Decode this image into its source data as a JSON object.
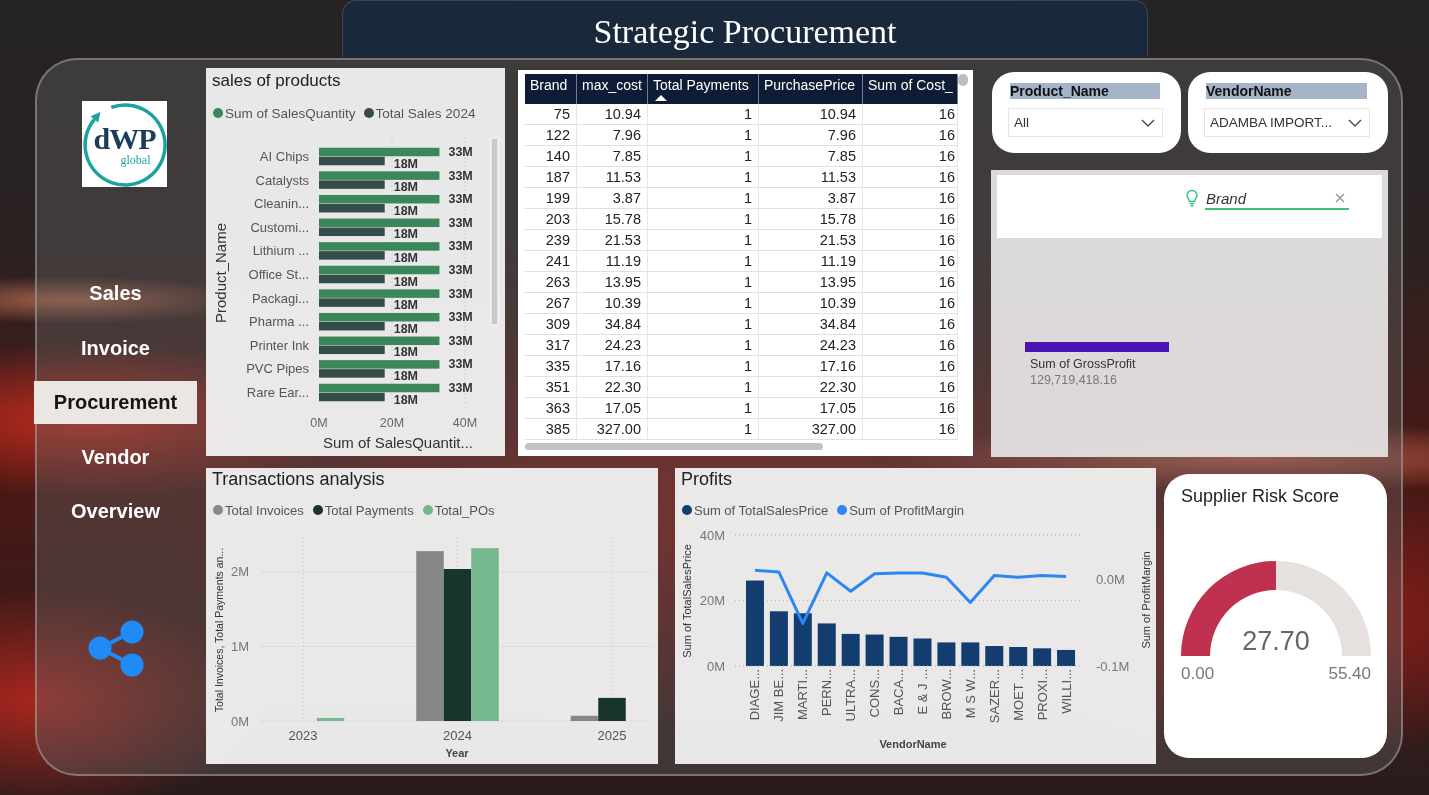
{
  "header": {
    "title": "Strategic Procurement"
  },
  "sidebar": {
    "logo": {
      "wordmark": "dWP",
      "tagline": "global"
    },
    "items": [
      {
        "label": "Sales",
        "selected": false
      },
      {
        "label": "Invoice",
        "selected": false
      },
      {
        "label": "Procurement",
        "selected": true
      },
      {
        "label": "Vendor",
        "selected": false
      },
      {
        "label": "Overview",
        "selected": false
      }
    ]
  },
  "sales_chart": {
    "chart_data": {
      "type": "bar",
      "orientation": "horizontal",
      "title": "sales of products",
      "xlabel": "Sum of SalesQuantit...",
      "ylabel": "Product_Name",
      "categories": [
        "AI Chips",
        "Catalysts",
        "Cleanin...",
        "Customi...",
        "Lithium ...",
        "Office St...",
        "Packagi...",
        "Pharma ...",
        "Printer Ink",
        "PVC Pipes",
        "Rare Ear..."
      ],
      "series": [
        {
          "name": "Sum of SalesQuantity",
          "color": "#3b875b",
          "values": [
            33000000,
            33000000,
            33000000,
            33000000,
            33000000,
            33000000,
            33000000,
            33000000,
            33000000,
            33000000,
            33000000
          ]
        },
        {
          "name": "Total Sales 2024",
          "color": "#354d48",
          "values": [
            18000000,
            18000000,
            18000000,
            18000000,
            18000000,
            18000000,
            18000000,
            18000000,
            18000000,
            18000000,
            18000000
          ]
        }
      ],
      "xlim": [
        0,
        40000000
      ],
      "xticks": [
        {
          "value": 0,
          "label": "0M"
        },
        {
          "value": 20000000,
          "label": "20M"
        },
        {
          "value": 40000000,
          "label": "40M"
        }
      ],
      "value_labels": [
        [
          "33M",
          "33M",
          "33M",
          "33M",
          "33M",
          "33M",
          "33M",
          "33M",
          "33M",
          "33M",
          "33M"
        ],
        [
          "18M",
          "18M",
          "18M",
          "18M",
          "18M",
          "18M",
          "18M",
          "18M",
          "18M",
          "18M",
          "18M"
        ]
      ],
      "legend": "top-left",
      "grid": true
    }
  },
  "brand_table": {
    "columns": [
      {
        "label": "Brand",
        "sorted": false
      },
      {
        "label": "max_cost",
        "sorted": false
      },
      {
        "label": "Total Payments",
        "sorted": true
      },
      {
        "label": "PurchasePrice",
        "sorted": false
      },
      {
        "label": "Sum of Cost_",
        "sorted": false
      }
    ],
    "rows": [
      [
        "75",
        "10.94",
        "1",
        "10.94",
        "16"
      ],
      [
        "122",
        "7.96",
        "1",
        "7.96",
        "16"
      ],
      [
        "140",
        "7.85",
        "1",
        "7.85",
        "16"
      ],
      [
        "187",
        "11.53",
        "1",
        "11.53",
        "16"
      ],
      [
        "199",
        "3.87",
        "1",
        "3.87",
        "16"
      ],
      [
        "203",
        "15.78",
        "1",
        "15.78",
        "16"
      ],
      [
        "239",
        "21.53",
        "1",
        "21.53",
        "16"
      ],
      [
        "241",
        "11.19",
        "1",
        "11.19",
        "16"
      ],
      [
        "263",
        "13.95",
        "1",
        "13.95",
        "16"
      ],
      [
        "267",
        "10.39",
        "1",
        "10.39",
        "16"
      ],
      [
        "309",
        "34.84",
        "1",
        "34.84",
        "16"
      ],
      [
        "317",
        "24.23",
        "1",
        "24.23",
        "16"
      ],
      [
        "335",
        "17.16",
        "1",
        "17.16",
        "16"
      ],
      [
        "351",
        "22.30",
        "1",
        "22.30",
        "16"
      ],
      [
        "363",
        "17.05",
        "1",
        "17.05",
        "16"
      ],
      [
        "385",
        "327.00",
        "1",
        "327.00",
        "16"
      ]
    ]
  },
  "slicers": [
    {
      "label": "Product_Name",
      "value": "All"
    },
    {
      "label": "VendorName",
      "value": "ADAMBA IMPORT..."
    }
  ],
  "qna": {
    "question": "Brand",
    "answer_label": "Sum of GrossProfit",
    "answer_value": "129,719,418.16"
  },
  "transactions_chart": {
    "chart_data": {
      "type": "bar",
      "title": "Transactions analysis",
      "xlabel": "Year",
      "ylabel": "Total Invoices, Total Payments an...",
      "categories": [
        "2023",
        "2024",
        "2025"
      ],
      "series": [
        {
          "name": "Total Invoices",
          "color": "#878787",
          "values": [
            0,
            2280000,
            70000
          ]
        },
        {
          "name": "Total Payments",
          "color": "#17352c",
          "values": [
            0,
            2040000,
            310000
          ]
        },
        {
          "name": "Total_POs",
          "color": "#76b88e",
          "values": [
            40000,
            2320000,
            0
          ]
        }
      ],
      "ylim": [
        0,
        2460000
      ],
      "yticks": [
        {
          "value": 0,
          "label": "0M"
        },
        {
          "value": 1000000,
          "label": "1M"
        },
        {
          "value": 2000000,
          "label": "2M"
        }
      ],
      "legend": "top-left",
      "grid": true
    }
  },
  "profits_chart": {
    "chart_data": {
      "type": "bar",
      "title": "Profits",
      "xlabel": "VendorName",
      "ylabel": "Sum of TotalSalesPrice",
      "categories": [
        "DIAGE...",
        "JIM BE...",
        "MARTI...",
        "PERN...",
        "ULTRA...",
        "CONS...",
        "BACA...",
        "E & J ...",
        "BROW...",
        "M S W...",
        "SAZER...",
        "MOET ...",
        "PROXI...",
        "WILLI..."
      ],
      "series": [
        {
          "name": "Sum of TotalSalesPrice",
          "color": "#133d6f",
          "values": [
            26100000,
            16700000,
            16100000,
            13000000,
            9800000,
            9600000,
            8900000,
            8400000,
            7200000,
            7200000,
            6100000,
            5800000,
            5400000,
            4900000
          ]
        }
      ],
      "ylim": [
        0,
        40000000
      ],
      "yticks": [
        {
          "value": 0,
          "label": "0M"
        },
        {
          "value": 20000000,
          "label": "20M"
        },
        {
          "value": 40000000,
          "label": "40M"
        }
      ],
      "legend": "top-left",
      "grid": true
    },
    "line_overlay": {
      "chart_data": {
        "type": "line",
        "ylabel": "Sum of ProfitMargin",
        "series": [
          {
            "name": "Sum of ProfitMargin",
            "color": "#2b88f2",
            "values": [
              10000,
              8000,
              -51000,
              7000,
              -14000,
              6000,
              7000,
              7000,
              2000,
              -27000,
              4000,
              2000,
              4000,
              3000
            ]
          }
        ],
        "ylim": [
          -100000,
          50600
        ],
        "yticks": [
          {
            "value": -100000,
            "label": "-0.1M"
          },
          {
            "value": 0,
            "label": "0.0M"
          }
        ],
        "legend": "top-left"
      }
    }
  },
  "risk_gauge": {
    "title": "Supplier Risk Score",
    "value": "27.70",
    "min": "0.00",
    "max": "55.40",
    "level": 0.5
  }
}
